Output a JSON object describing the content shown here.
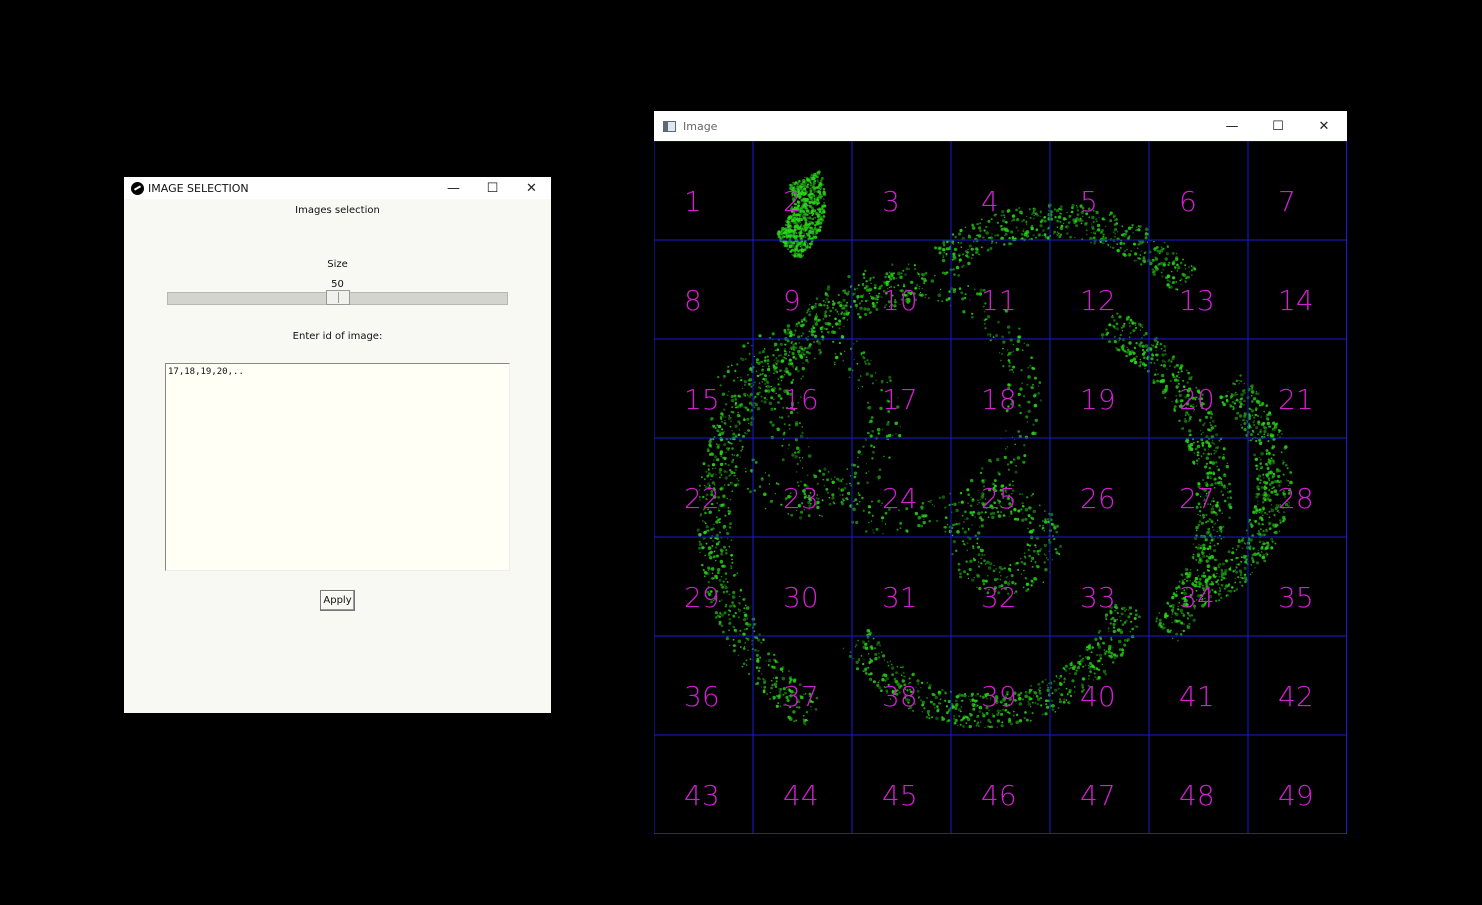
{
  "selection_window": {
    "title": "IMAGE SELECTION",
    "heading": "Images selection",
    "size_label": "Size",
    "size_value": "50",
    "size_fraction": 0.5,
    "id_label": "Enter id of image:",
    "id_input_value": "17,18,19,20,..",
    "apply_label": "Apply",
    "controls": {
      "minimize": "—",
      "maximize": "☐",
      "close": "✕"
    }
  },
  "image_window": {
    "title": "Image",
    "controls": {
      "minimize": "—",
      "maximize": "☐",
      "close": "✕"
    },
    "grid": {
      "rows": 7,
      "cols": 7,
      "labels": [
        "1",
        "2",
        "3",
        "4",
        "5",
        "6",
        "7",
        "8",
        "9",
        "10",
        "11",
        "12",
        "13",
        "14",
        "15",
        "16",
        "17",
        "18",
        "19",
        "20",
        "21",
        "22",
        "23",
        "24",
        "25",
        "26",
        "27",
        "28",
        "29",
        "30",
        "31",
        "32",
        "33",
        "34",
        "35",
        "36",
        "37",
        "38",
        "39",
        "40",
        "41",
        "42",
        "43",
        "44",
        "45",
        "46",
        "47",
        "48",
        "49"
      ],
      "line_color": "#1a1ad8",
      "label_color": "#d020d0",
      "tissue_color": "#2ad41a"
    }
  }
}
